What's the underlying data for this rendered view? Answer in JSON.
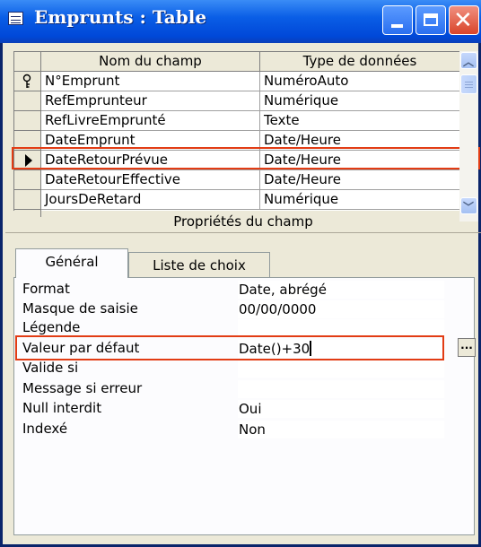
{
  "window": {
    "title": "Emprunts : Table",
    "icon": "table-icon",
    "buttons": [
      "minimize-icon",
      "maximize-icon",
      "close-icon"
    ]
  },
  "grid": {
    "columns": [
      "Nom du champ",
      "Type de données"
    ],
    "rows": [
      {
        "name": "N°Emprunt",
        "type": "NuméroAuto",
        "indicator": "key-icon"
      },
      {
        "name": "RefEmprunteur",
        "type": "Numérique",
        "indicator": ""
      },
      {
        "name": "RefLivreEmprunté",
        "type": "Texte",
        "indicator": ""
      },
      {
        "name": "DateEmprunt",
        "type": "Date/Heure",
        "indicator": ""
      },
      {
        "name": "DateRetourPrévue",
        "type": "Date/Heure",
        "indicator": "current-row-arrow-icon",
        "highlighted": true
      },
      {
        "name": "DateRetourEffective",
        "type": "Date/Heure",
        "indicator": ""
      },
      {
        "name": "JoursDeRetard",
        "type": "Numérique",
        "indicator": ""
      }
    ]
  },
  "properties": {
    "title": "Propriétés du champ",
    "tabs": [
      "Général",
      "Liste de choix"
    ],
    "active_tab": "Général",
    "items": [
      {
        "label": "Format",
        "value": "Date, abrégé"
      },
      {
        "label": "Masque de saisie",
        "value": "00/00/0000"
      },
      {
        "label": "Légende",
        "value": ""
      },
      {
        "label": "Valeur par défaut",
        "value": "Date()+30",
        "highlighted": true
      },
      {
        "label": "Valide si",
        "value": ""
      },
      {
        "label": "Message si erreur",
        "value": ""
      },
      {
        "label": "Null interdit",
        "value": "Oui"
      },
      {
        "label": "Indexé",
        "value": "Non"
      }
    ],
    "build_button": "..."
  },
  "colors": {
    "titlebar": "#0a5ee6",
    "window_bg": "#ece9d8",
    "highlight": "#e23c14",
    "close_button": "#d9442a"
  }
}
